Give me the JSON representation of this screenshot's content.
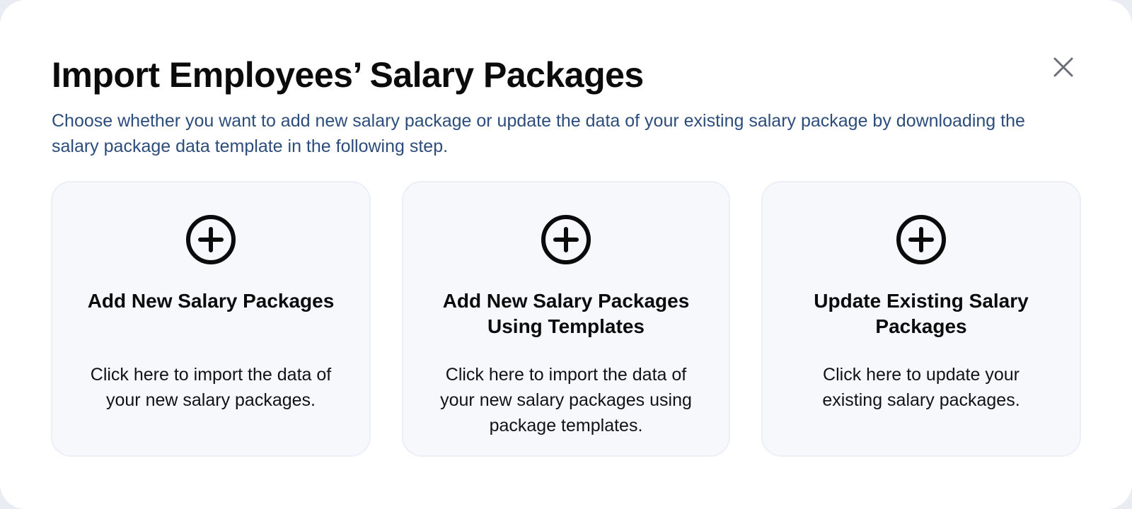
{
  "dialog": {
    "title": "Import Employees’ Salary Packages",
    "description": "Choose whether you want to add new salary package or update the data of your existing salary package by downloading the salary package data template in the following step.",
    "close_icon": "close-icon"
  },
  "options": [
    {
      "icon": "plus-circle-icon",
      "title": "Add New Salary Packages",
      "description": "Click here to import the data of your new salary packages."
    },
    {
      "icon": "plus-circle-icon",
      "title": "Add New Salary Packages Using Templates",
      "description": "Click here to import the data of your new salary packages using package templates."
    },
    {
      "icon": "plus-circle-icon",
      "title": "Update Existing Salary Packages",
      "description": "Click here to update your existing salary packages."
    }
  ],
  "colors": {
    "title": "#0b0b0c",
    "description": "#2c4d7c",
    "card_background": "#f7f8fc",
    "card_border": "#eceff7"
  }
}
